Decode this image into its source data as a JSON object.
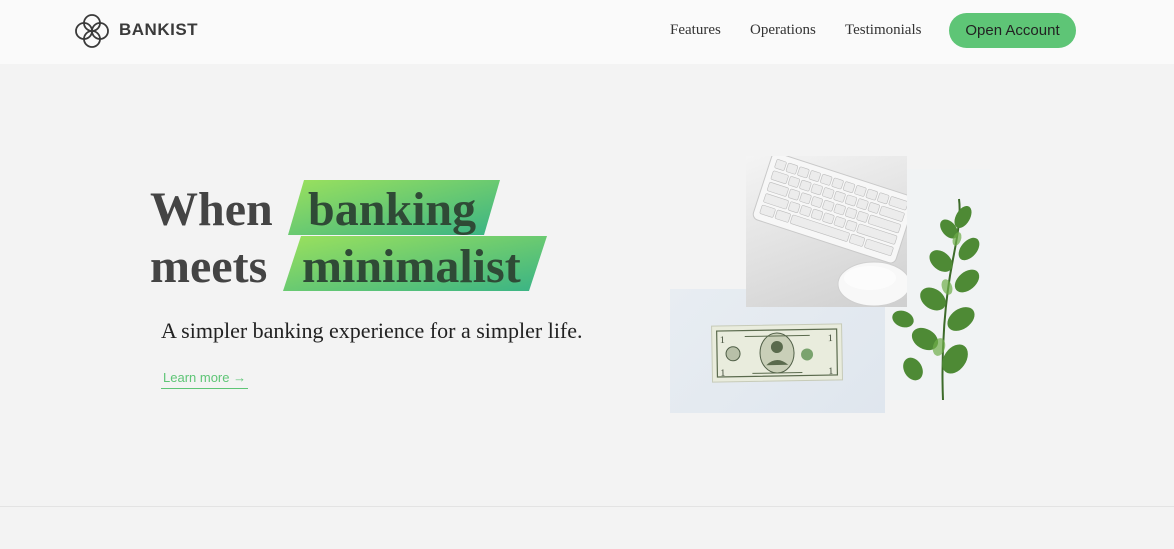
{
  "nav": {
    "brand": "BANKIST",
    "logo_icon": "bankist-logo-icon",
    "links": [
      "Features",
      "Operations",
      "Testimonials"
    ],
    "cta": "Open Account"
  },
  "hero": {
    "title_word_1": "When",
    "title_highlight_1": "banking",
    "title_word_2": "meets",
    "title_highlight_2": "minimalist",
    "subtitle": "A simpler banking experience for a simpler life.",
    "learn_more": "Learn more →"
  },
  "colors": {
    "accent": "#5ec576",
    "highlight_start": "#9be15d",
    "highlight_end": "#39b385",
    "nav_bg": "#fafafa",
    "page_bg": "#f3f3f3"
  }
}
